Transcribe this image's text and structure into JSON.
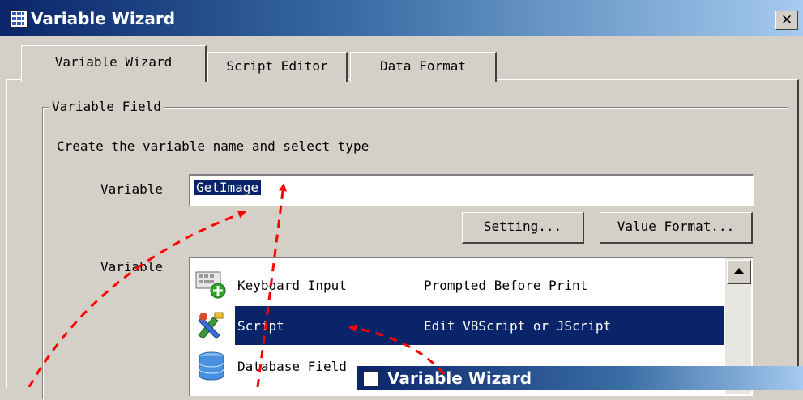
{
  "window": {
    "title": "Variable Wizard",
    "close_glyph": "✕"
  },
  "tabs": [
    {
      "label": "Variable Wizard",
      "active": true
    },
    {
      "label": "Script Editor",
      "active": false
    },
    {
      "label": "Data Format",
      "active": false
    }
  ],
  "group": {
    "title": "Variable Field",
    "instruction": "Create the variable name and select type"
  },
  "variable": {
    "label": "Variable",
    "value": "GetImage"
  },
  "buttons": {
    "setting_underlined": "S",
    "setting_rest": "etting...",
    "value_format": "Value Format..."
  },
  "type_list": {
    "label": "Variable",
    "items": [
      {
        "name": "Keyboard Input",
        "description": "Prompted Before Print",
        "icon": "keyboard-add-icon",
        "selected": false
      },
      {
        "name": "Script",
        "description": "Edit VBScript or JScript",
        "icon": "script-tools-icon",
        "selected": true
      },
      {
        "name": "Database Field",
        "description": "",
        "icon": "database-icon",
        "selected": false
      }
    ]
  },
  "overlay_window": {
    "title": "Variable Wizard"
  },
  "colors": {
    "selection": "#0a246a",
    "annotation_arrows": "#ff0000",
    "face": "#d4d0c8"
  }
}
